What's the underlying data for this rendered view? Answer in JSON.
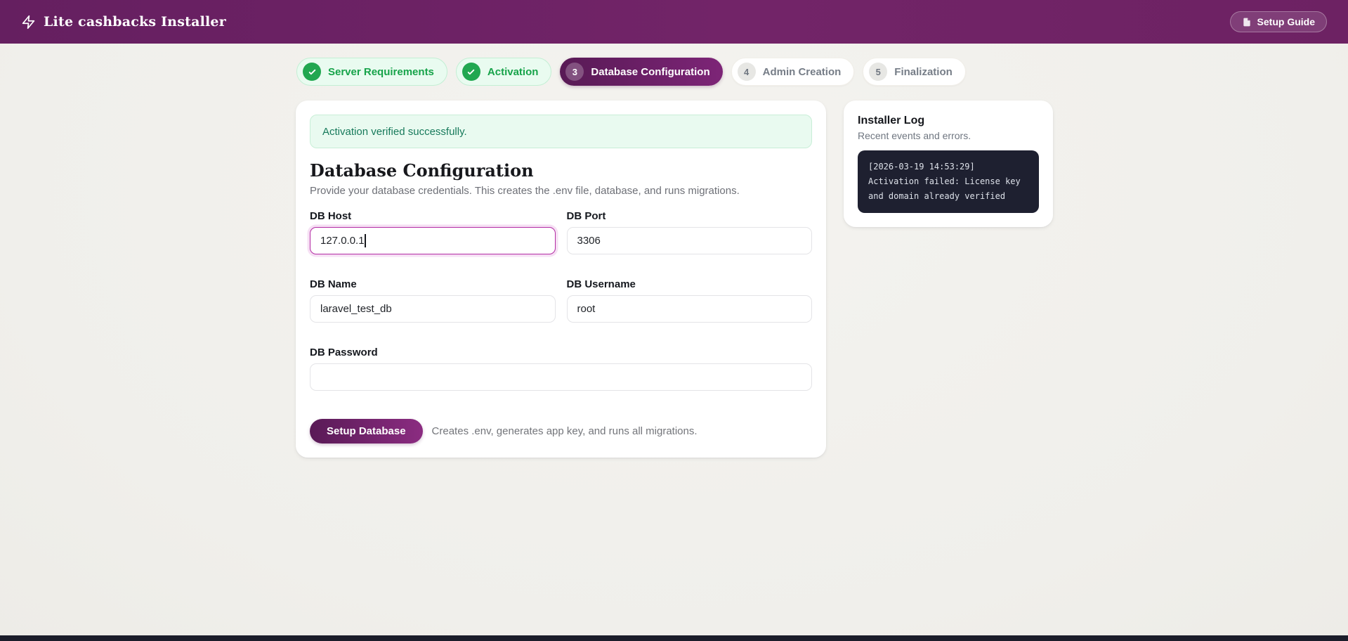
{
  "header": {
    "brand": "Lite cashbacks Installer",
    "setup_guide_label": "Setup Guide"
  },
  "stepper": {
    "steps": [
      {
        "label": "Server Requirements",
        "status": "complete"
      },
      {
        "label": "Activation",
        "status": "complete"
      },
      {
        "label": "Database Configuration",
        "number": "3",
        "status": "active"
      },
      {
        "label": "Admin Creation",
        "number": "4",
        "status": "pending"
      },
      {
        "label": "Finalization",
        "number": "5",
        "status": "pending"
      }
    ]
  },
  "main": {
    "alert": "Activation verified successfully.",
    "title": "Database Configuration",
    "subtitle": "Provide your database credentials. This creates the .env file, database, and runs migrations.",
    "fields": {
      "db_host": {
        "label": "DB Host",
        "value": "127.0.0.1"
      },
      "db_port": {
        "label": "DB Port",
        "value": "3306"
      },
      "db_name": {
        "label": "DB Name",
        "value": "laravel_test_db"
      },
      "db_username": {
        "label": "DB Username",
        "value": "root"
      },
      "db_password": {
        "label": "DB Password",
        "value": ""
      }
    },
    "submit_label": "Setup Database",
    "submit_help": "Creates .env, generates app key, and runs all migrations."
  },
  "sidebar": {
    "title": "Installer Log",
    "subtitle": "Recent events and errors.",
    "log": "[2026-03-19 14:53:29] Activation failed: License key and domain already verified"
  },
  "colors": {
    "header_purple": "#6d2267",
    "active_step_purple": "#6b2065",
    "success_green": "#17a34a",
    "alert_bg": "#e9faf0",
    "alert_text": "#177a5b",
    "focus_ring_magenta": "#b32ba4",
    "log_bg": "#1e2030",
    "page_bg": "#f2f1ee"
  }
}
